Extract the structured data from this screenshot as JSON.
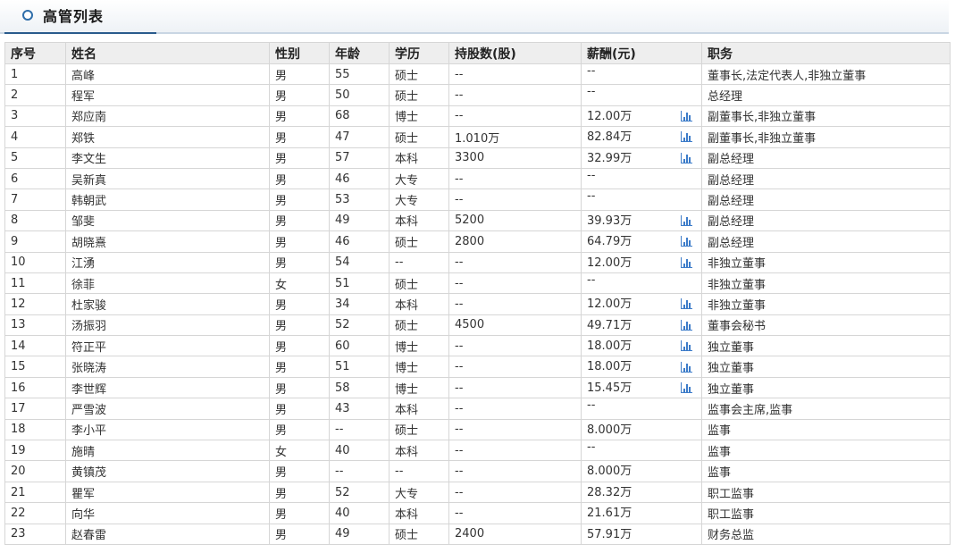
{
  "title": "高管列表",
  "columns": [
    "序号",
    "姓名",
    "性别",
    "年龄",
    "学历",
    "持股数(股)",
    "薪酬(元)",
    "职务"
  ],
  "rows": [
    {
      "no": "1",
      "name": "高峰",
      "gender": "男",
      "age": "55",
      "edu": "硕士",
      "shares": "--",
      "salary": "--",
      "chart": false,
      "title": "董事长,法定代表人,非独立董事"
    },
    {
      "no": "2",
      "name": "程军",
      "gender": "男",
      "age": "50",
      "edu": "硕士",
      "shares": "--",
      "salary": "--",
      "chart": false,
      "title": "总经理"
    },
    {
      "no": "3",
      "name": "郑应南",
      "gender": "男",
      "age": "68",
      "edu": "博士",
      "shares": "--",
      "salary": "12.00万",
      "chart": true,
      "title": "副董事长,非独立董事"
    },
    {
      "no": "4",
      "name": "郑铁",
      "gender": "男",
      "age": "47",
      "edu": "硕士",
      "shares": "1.010万",
      "salary": "82.84万",
      "chart": true,
      "title": "副董事长,非独立董事"
    },
    {
      "no": "5",
      "name": "李文生",
      "gender": "男",
      "age": "57",
      "edu": "本科",
      "shares": "3300",
      "salary": "32.99万",
      "chart": true,
      "title": "副总经理"
    },
    {
      "no": "6",
      "name": "吴新真",
      "gender": "男",
      "age": "46",
      "edu": "大专",
      "shares": "--",
      "salary": "--",
      "chart": false,
      "title": "副总经理"
    },
    {
      "no": "7",
      "name": "韩朝武",
      "gender": "男",
      "age": "53",
      "edu": "大专",
      "shares": "--",
      "salary": "--",
      "chart": false,
      "title": "副总经理"
    },
    {
      "no": "8",
      "name": "邹斐",
      "gender": "男",
      "age": "49",
      "edu": "本科",
      "shares": "5200",
      "salary": "39.93万",
      "chart": true,
      "title": "副总经理"
    },
    {
      "no": "9",
      "name": "胡晓熹",
      "gender": "男",
      "age": "46",
      "edu": "硕士",
      "shares": "2800",
      "salary": "64.79万",
      "chart": true,
      "title": "副总经理"
    },
    {
      "no": "10",
      "name": "江湧",
      "gender": "男",
      "age": "54",
      "edu": "--",
      "shares": "--",
      "salary": "12.00万",
      "chart": true,
      "title": "非独立董事"
    },
    {
      "no": "11",
      "name": "徐菲",
      "gender": "女",
      "age": "51",
      "edu": "硕士",
      "shares": "--",
      "salary": "--",
      "chart": false,
      "title": "非独立董事"
    },
    {
      "no": "12",
      "name": "杜家骏",
      "gender": "男",
      "age": "34",
      "edu": "本科",
      "shares": "--",
      "salary": "12.00万",
      "chart": true,
      "title": "非独立董事"
    },
    {
      "no": "13",
      "name": "汤振羽",
      "gender": "男",
      "age": "52",
      "edu": "硕士",
      "shares": "4500",
      "salary": "49.71万",
      "chart": true,
      "title": "董事会秘书"
    },
    {
      "no": "14",
      "name": "符正平",
      "gender": "男",
      "age": "60",
      "edu": "博士",
      "shares": "--",
      "salary": "18.00万",
      "chart": true,
      "title": "独立董事"
    },
    {
      "no": "15",
      "name": "张晓涛",
      "gender": "男",
      "age": "51",
      "edu": "博士",
      "shares": "--",
      "salary": "18.00万",
      "chart": true,
      "title": "独立董事"
    },
    {
      "no": "16",
      "name": "李世辉",
      "gender": "男",
      "age": "58",
      "edu": "博士",
      "shares": "--",
      "salary": "15.45万",
      "chart": true,
      "title": "独立董事"
    },
    {
      "no": "17",
      "name": "严雪波",
      "gender": "男",
      "age": "43",
      "edu": "本科",
      "shares": "--",
      "salary": "--",
      "chart": false,
      "title": "监事会主席,监事"
    },
    {
      "no": "18",
      "name": "李小平",
      "gender": "男",
      "age": "--",
      "edu": "硕士",
      "shares": "--",
      "salary": "8.000万",
      "chart": false,
      "title": "监事"
    },
    {
      "no": "19",
      "name": "施晴",
      "gender": "女",
      "age": "40",
      "edu": "本科",
      "shares": "--",
      "salary": "--",
      "chart": false,
      "title": "监事"
    },
    {
      "no": "20",
      "name": "黄镇茂",
      "gender": "男",
      "age": "--",
      "edu": "--",
      "shares": "--",
      "salary": "8.000万",
      "chart": false,
      "title": "监事"
    },
    {
      "no": "21",
      "name": "瞿军",
      "gender": "男",
      "age": "52",
      "edu": "大专",
      "shares": "--",
      "salary": "28.32万",
      "chart": false,
      "title": "职工监事"
    },
    {
      "no": "22",
      "name": "向华",
      "gender": "男",
      "age": "40",
      "edu": "本科",
      "shares": "--",
      "salary": "21.61万",
      "chart": false,
      "title": "职工监事"
    },
    {
      "no": "23",
      "name": "赵春雷",
      "gender": "男",
      "age": "49",
      "edu": "硕士",
      "shares": "2400",
      "salary": "57.91万",
      "chart": false,
      "title": "财务总监"
    }
  ],
  "icons": {
    "salary_chart": "bar-chart-icon"
  },
  "colors": {
    "accent": "#2a5b8c",
    "icon": "#3d7cc9",
    "header_bg": "#eeeeee",
    "border": "#d6d6d6"
  }
}
